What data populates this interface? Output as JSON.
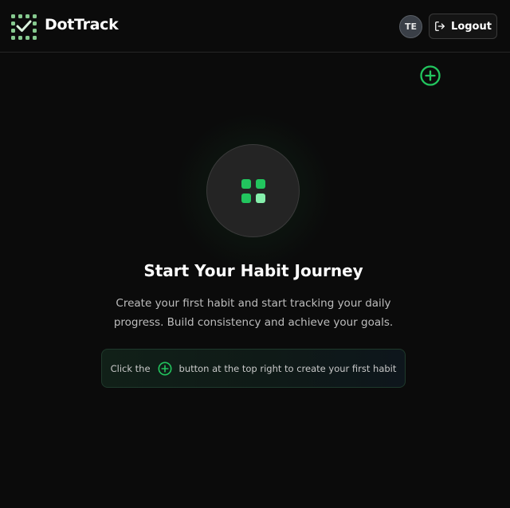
{
  "header": {
    "brand": "DotTrack",
    "logo_icon": "dot-grid-check-icon",
    "avatar_initials": "TE",
    "logout_label": "Logout",
    "logout_icon": "logout-icon"
  },
  "toolbar": {
    "add_icon": "plus-circle-icon"
  },
  "empty_state": {
    "icon": "habit-grid-icon",
    "title": "Start Your Habit Journey",
    "description": "Create your first habit and start tracking your daily progress. Build consistency and achieve your goals.",
    "hint_before": "Click the",
    "hint_icon": "plus-circle-icon",
    "hint_after": "button at the top right to create your first habit"
  },
  "colors": {
    "background": "#0b0b0b",
    "accent_green": "#22c55e",
    "light_green": "#86efac",
    "text_muted": "#bdbdbd"
  }
}
